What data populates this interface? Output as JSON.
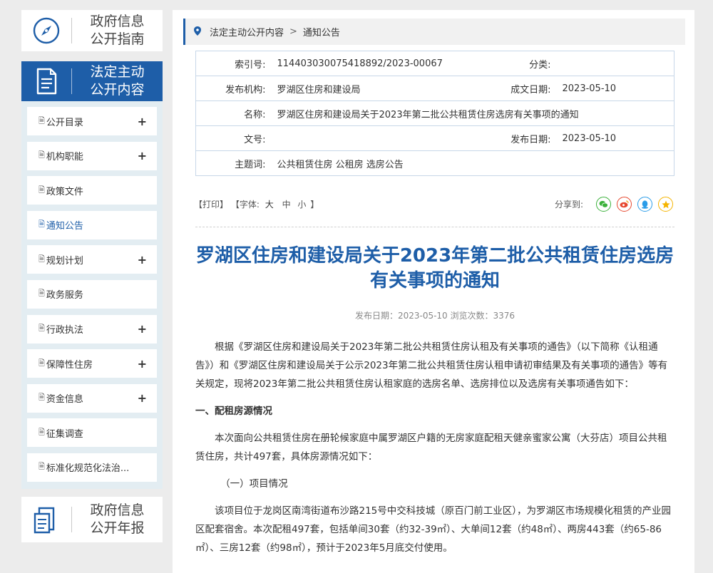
{
  "sidebar": {
    "guide_title": [
      "政府信息",
      "公开指南"
    ],
    "active_title": [
      "法定主动",
      "公开内容"
    ],
    "annual_title": [
      "政府信息",
      "公开年报"
    ],
    "items": [
      {
        "label": "公开目录",
        "expandable": true
      },
      {
        "label": "机构职能",
        "expandable": true
      },
      {
        "label": "政策文件",
        "expandable": false
      },
      {
        "label": "通知公告",
        "expandable": false,
        "active": true
      },
      {
        "label": "规划计划",
        "expandable": true
      },
      {
        "label": "政务服务",
        "expandable": false
      },
      {
        "label": "行政执法",
        "expandable": true
      },
      {
        "label": "保障性住房",
        "expandable": true
      },
      {
        "label": "资金信息",
        "expandable": true
      },
      {
        "label": "征集调查",
        "expandable": false
      },
      {
        "label": "标准化规范化法治...",
        "expandable": false
      }
    ],
    "plus_glyph": "+"
  },
  "breadcrumb": {
    "items": [
      "法定主动公开内容",
      "通知公告"
    ],
    "separator": ">"
  },
  "meta": {
    "index_label": "索引号:",
    "index_value": "114403030075418892/2023-00067",
    "category_label": "分类:",
    "category_value": "",
    "publisher_label": "发布机构:",
    "publisher_value": "罗湖区住房和建设局",
    "created_label": "成文日期:",
    "created_value": "2023-05-10",
    "name_label": "名称:",
    "name_value": "罗湖区住房和建设局关于2023年第二批公共租赁住房选房有关事项的通知",
    "docno_label": "文号:",
    "docno_value": "",
    "pubdate_label": "发布日期:",
    "pubdate_value": "2023-05-10",
    "keywords_label": "主题词:",
    "keywords_value": "公共租赁住房 公租房 选房公告"
  },
  "tools": {
    "print": "【打印】",
    "font_prefix": "【字体:",
    "font_large": "大",
    "font_medium": "中",
    "font_small": "小",
    "font_suffix": "】",
    "share_label": "分享到:",
    "share_icons": [
      "wechat-icon",
      "weibo-icon",
      "qq-icon",
      "qzone-icon"
    ],
    "colors": {
      "wechat": "#3bb13b",
      "weibo": "#e6482f",
      "qq": "#2a9ce8",
      "qzone": "#f5b400"
    }
  },
  "article": {
    "title": "罗湖区住房和建设局关于2023年第二批公共租赁住房选房有关事项的通知",
    "pub_info": "发布日期：2023-05-10  浏览次数：3376",
    "paragraphs": [
      "根据《罗湖区住房和建设局关于2023年第二批公共租赁住房认租及有关事项的通告》（以下简称《认租通告》）和《罗湖区住房和建设局关于公示2023年第二批公共租赁住房认租申请初审结果及有关事项的通告》等有关规定，现将2023年第二批公共租赁住房认租家庭的选房名单、选房排位以及选房有关事项通告如下：",
      "一、配租房源情况",
      "本次面向公共租赁住房在册轮候家庭中属罗湖区户籍的无房家庭配租天健亲蜜家公寓（大芬店）项目公共租赁住房，共计497套，具体房源情况如下：",
      "（一）项目情况",
      "该项目位于龙岗区南湾街道布沙路215号中交科技城（原百门前工业区），为罗湖区市场规模化租赁的产业园区配套宿舍。本次配租497套，包括单间30套（约32-39㎡）、大单间12套（约48㎡）、两房443套（约65-86㎡）、三房12套（约98㎡），预计于2023年5月底交付使用。"
    ]
  },
  "colors": {
    "accent": "#1e5ea8",
    "menu_bg": "#e3edf2",
    "table_border": "#c7d7e8"
  }
}
